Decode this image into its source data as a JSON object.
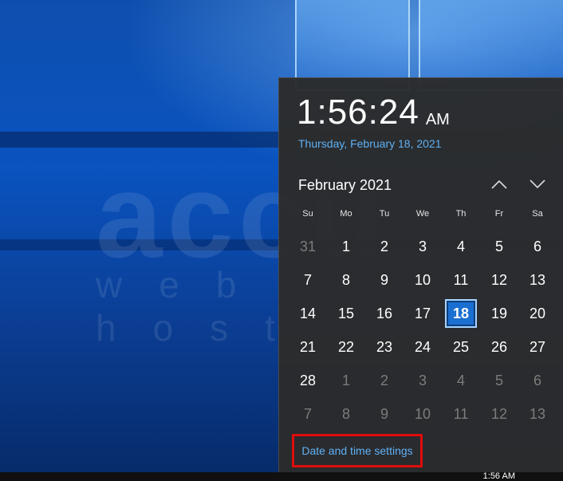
{
  "clock": {
    "time": "1:56:24",
    "ampm": "AM",
    "date": "Thursday, February 18, 2021"
  },
  "calendar": {
    "month_label": "February 2021",
    "weekdays": [
      "Su",
      "Mo",
      "Tu",
      "We",
      "Th",
      "Fr",
      "Sa"
    ],
    "weeks": [
      [
        {
          "d": "31",
          "other": true
        },
        {
          "d": "1"
        },
        {
          "d": "2"
        },
        {
          "d": "3"
        },
        {
          "d": "4"
        },
        {
          "d": "5"
        },
        {
          "d": "6"
        }
      ],
      [
        {
          "d": "7"
        },
        {
          "d": "8"
        },
        {
          "d": "9"
        },
        {
          "d": "10"
        },
        {
          "d": "11"
        },
        {
          "d": "12"
        },
        {
          "d": "13"
        }
      ],
      [
        {
          "d": "14"
        },
        {
          "d": "15"
        },
        {
          "d": "16"
        },
        {
          "d": "17"
        },
        {
          "d": "18",
          "today": true
        },
        {
          "d": "19"
        },
        {
          "d": "20"
        }
      ],
      [
        {
          "d": "21"
        },
        {
          "d": "22"
        },
        {
          "d": "23"
        },
        {
          "d": "24"
        },
        {
          "d": "25"
        },
        {
          "d": "26"
        },
        {
          "d": "27"
        }
      ],
      [
        {
          "d": "28"
        },
        {
          "d": "1",
          "other": true
        },
        {
          "d": "2",
          "other": true
        },
        {
          "d": "3",
          "other": true
        },
        {
          "d": "4",
          "other": true
        },
        {
          "d": "5",
          "other": true
        },
        {
          "d": "6",
          "other": true
        }
      ],
      [
        {
          "d": "7",
          "other": true
        },
        {
          "d": "8",
          "other": true
        },
        {
          "d": "9",
          "other": true
        },
        {
          "d": "10",
          "other": true
        },
        {
          "d": "11",
          "other": true
        },
        {
          "d": "12",
          "other": true
        },
        {
          "d": "13",
          "other": true
        }
      ]
    ],
    "prev_icon": "chevron-up-icon",
    "next_icon": "chevron-down-icon"
  },
  "settings_link": "Date and time settings",
  "watermark": {
    "brand": "accu",
    "tagline": "web hosting"
  },
  "taskbar": {
    "clock": "1:56 AM"
  },
  "colors": {
    "accent": "#5fb1f5",
    "today": "#1a6fd1",
    "highlight_border": "#e00c0c",
    "flyout_bg": "#2b2b2b"
  }
}
